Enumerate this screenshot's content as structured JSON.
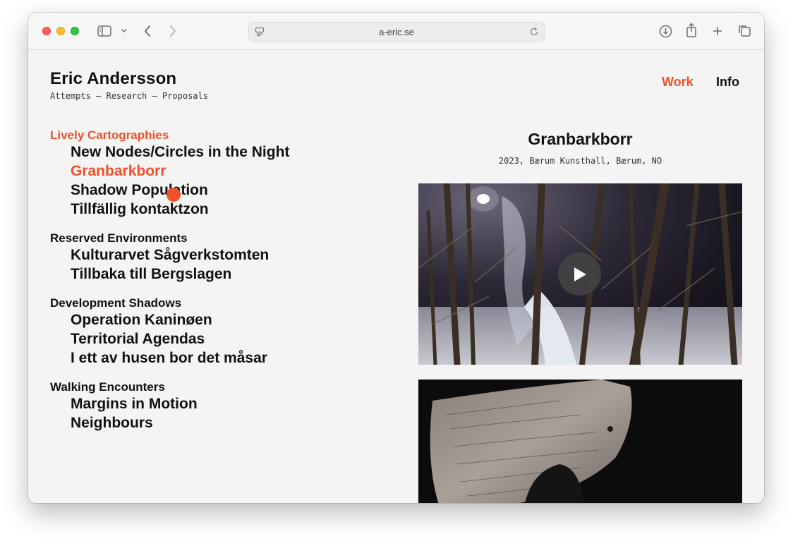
{
  "browser": {
    "url": "a-eric.se",
    "icons": {
      "sidebar": "sidebar-icon",
      "chevron": "chevron-down-icon",
      "back": "chevron-left-icon",
      "forward": "chevron-right-icon",
      "site": "site-settings-icon",
      "reload": "reload-icon",
      "download": "download-icon",
      "share": "share-icon",
      "new_tab": "plus-icon",
      "tabs": "tab-overview-icon"
    }
  },
  "site": {
    "title": "Eric Andersson",
    "tagline": "Attempts – Research – Proposals",
    "accent_color": "#f0502a"
  },
  "nav": {
    "work": "Work",
    "info": "Info",
    "active": "Work"
  },
  "menu": {
    "groups": [
      {
        "title": "Lively Cartographies",
        "active": true,
        "items": [
          {
            "label": "New Nodes/Circles in the Night",
            "active": false
          },
          {
            "label": "Granbarkborr",
            "active": true
          },
          {
            "label": "Shadow Population",
            "active": false
          },
          {
            "label": "Tillfällig kontaktzon",
            "active": false
          }
        ]
      },
      {
        "title": "Reserved Environments",
        "active": false,
        "items": [
          {
            "label": "Kulturarvet Sågverkstomten",
            "active": false
          },
          {
            "label": "Tillbaka till Bergslagen",
            "active": false
          }
        ]
      },
      {
        "title": "Development Shadows",
        "active": false,
        "items": [
          {
            "label": "Operation Kaninøen",
            "active": false
          },
          {
            "label": "Territorial Agendas",
            "active": false
          },
          {
            "label": "I ett av husen bor det måsar",
            "active": false
          }
        ]
      },
      {
        "title": "Walking Encounters",
        "active": false,
        "items": [
          {
            "label": "Margins in Motion",
            "active": false
          },
          {
            "label": "Neighbours",
            "active": false
          }
        ]
      }
    ]
  },
  "detail": {
    "title": "Granbarkborr",
    "meta": "2023, Bærum Kunsthall, Bærum, NO",
    "media": [
      {
        "kind": "video",
        "icon": "play-icon"
      },
      {
        "kind": "image"
      }
    ]
  }
}
